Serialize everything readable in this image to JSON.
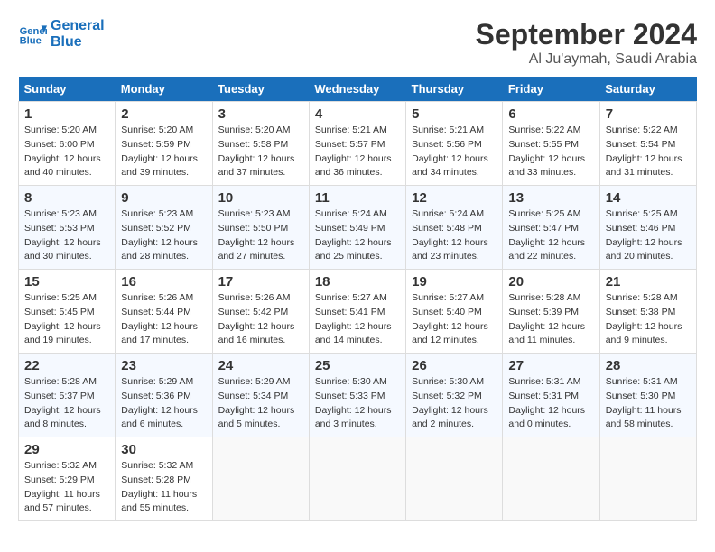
{
  "header": {
    "logo_line1": "General",
    "logo_line2": "Blue",
    "month": "September 2024",
    "location": "Al Ju'aymah, Saudi Arabia"
  },
  "weekdays": [
    "Sunday",
    "Monday",
    "Tuesday",
    "Wednesday",
    "Thursday",
    "Friday",
    "Saturday"
  ],
  "weeks": [
    [
      {
        "day": "1",
        "sunrise": "5:20 AM",
        "sunset": "6:00 PM",
        "daylight": "12 hours and 40 minutes."
      },
      {
        "day": "2",
        "sunrise": "5:20 AM",
        "sunset": "5:59 PM",
        "daylight": "12 hours and 39 minutes."
      },
      {
        "day": "3",
        "sunrise": "5:20 AM",
        "sunset": "5:58 PM",
        "daylight": "12 hours and 37 minutes."
      },
      {
        "day": "4",
        "sunrise": "5:21 AM",
        "sunset": "5:57 PM",
        "daylight": "12 hours and 36 minutes."
      },
      {
        "day": "5",
        "sunrise": "5:21 AM",
        "sunset": "5:56 PM",
        "daylight": "12 hours and 34 minutes."
      },
      {
        "day": "6",
        "sunrise": "5:22 AM",
        "sunset": "5:55 PM",
        "daylight": "12 hours and 33 minutes."
      },
      {
        "day": "7",
        "sunrise": "5:22 AM",
        "sunset": "5:54 PM",
        "daylight": "12 hours and 31 minutes."
      }
    ],
    [
      {
        "day": "8",
        "sunrise": "5:23 AM",
        "sunset": "5:53 PM",
        "daylight": "12 hours and 30 minutes."
      },
      {
        "day": "9",
        "sunrise": "5:23 AM",
        "sunset": "5:52 PM",
        "daylight": "12 hours and 28 minutes."
      },
      {
        "day": "10",
        "sunrise": "5:23 AM",
        "sunset": "5:50 PM",
        "daylight": "12 hours and 27 minutes."
      },
      {
        "day": "11",
        "sunrise": "5:24 AM",
        "sunset": "5:49 PM",
        "daylight": "12 hours and 25 minutes."
      },
      {
        "day": "12",
        "sunrise": "5:24 AM",
        "sunset": "5:48 PM",
        "daylight": "12 hours and 23 minutes."
      },
      {
        "day": "13",
        "sunrise": "5:25 AM",
        "sunset": "5:47 PM",
        "daylight": "12 hours and 22 minutes."
      },
      {
        "day": "14",
        "sunrise": "5:25 AM",
        "sunset": "5:46 PM",
        "daylight": "12 hours and 20 minutes."
      }
    ],
    [
      {
        "day": "15",
        "sunrise": "5:25 AM",
        "sunset": "5:45 PM",
        "daylight": "12 hours and 19 minutes."
      },
      {
        "day": "16",
        "sunrise": "5:26 AM",
        "sunset": "5:44 PM",
        "daylight": "12 hours and 17 minutes."
      },
      {
        "day": "17",
        "sunrise": "5:26 AM",
        "sunset": "5:42 PM",
        "daylight": "12 hours and 16 minutes."
      },
      {
        "day": "18",
        "sunrise": "5:27 AM",
        "sunset": "5:41 PM",
        "daylight": "12 hours and 14 minutes."
      },
      {
        "day": "19",
        "sunrise": "5:27 AM",
        "sunset": "5:40 PM",
        "daylight": "12 hours and 12 minutes."
      },
      {
        "day": "20",
        "sunrise": "5:28 AM",
        "sunset": "5:39 PM",
        "daylight": "12 hours and 11 minutes."
      },
      {
        "day": "21",
        "sunrise": "5:28 AM",
        "sunset": "5:38 PM",
        "daylight": "12 hours and 9 minutes."
      }
    ],
    [
      {
        "day": "22",
        "sunrise": "5:28 AM",
        "sunset": "5:37 PM",
        "daylight": "12 hours and 8 minutes."
      },
      {
        "day": "23",
        "sunrise": "5:29 AM",
        "sunset": "5:36 PM",
        "daylight": "12 hours and 6 minutes."
      },
      {
        "day": "24",
        "sunrise": "5:29 AM",
        "sunset": "5:34 PM",
        "daylight": "12 hours and 5 minutes."
      },
      {
        "day": "25",
        "sunrise": "5:30 AM",
        "sunset": "5:33 PM",
        "daylight": "12 hours and 3 minutes."
      },
      {
        "day": "26",
        "sunrise": "5:30 AM",
        "sunset": "5:32 PM",
        "daylight": "12 hours and 2 minutes."
      },
      {
        "day": "27",
        "sunrise": "5:31 AM",
        "sunset": "5:31 PM",
        "daylight": "12 hours and 0 minutes."
      },
      {
        "day": "28",
        "sunrise": "5:31 AM",
        "sunset": "5:30 PM",
        "daylight": "11 hours and 58 minutes."
      }
    ],
    [
      {
        "day": "29",
        "sunrise": "5:32 AM",
        "sunset": "5:29 PM",
        "daylight": "11 hours and 57 minutes."
      },
      {
        "day": "30",
        "sunrise": "5:32 AM",
        "sunset": "5:28 PM",
        "daylight": "11 hours and 55 minutes."
      },
      null,
      null,
      null,
      null,
      null
    ]
  ]
}
